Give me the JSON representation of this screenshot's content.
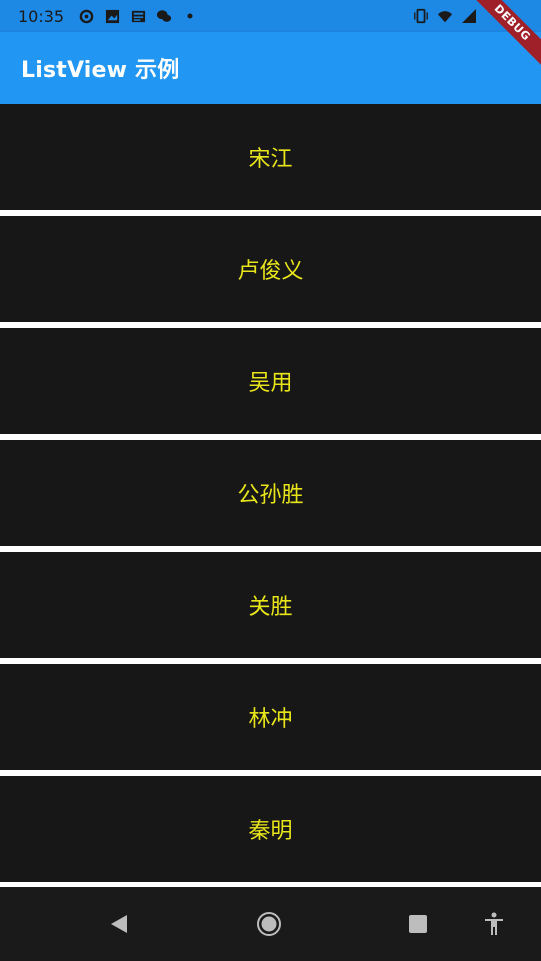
{
  "status_bar": {
    "time": "10:35",
    "icons_left": [
      "sync-icon",
      "image-icon",
      "news-icon",
      "wechat-icon",
      "dot-icon"
    ],
    "icons_right": [
      "vibrate-icon",
      "wifi-icon",
      "signal-icon"
    ]
  },
  "app_bar": {
    "title": "ListView 示例",
    "color": "#2196f3"
  },
  "debug_banner": "DEBUG",
  "list": {
    "item_background": "#171717",
    "item_text_color": "#e8e51a",
    "items": [
      {
        "label": "宋江"
      },
      {
        "label": "卢俊义"
      },
      {
        "label": "吴用"
      },
      {
        "label": "公孙胜"
      },
      {
        "label": "关胜"
      },
      {
        "label": "林冲"
      },
      {
        "label": "秦明"
      }
    ]
  },
  "nav_bar": {
    "buttons": [
      "back-icon",
      "home-icon",
      "recents-icon",
      "accessibility-icon"
    ]
  }
}
